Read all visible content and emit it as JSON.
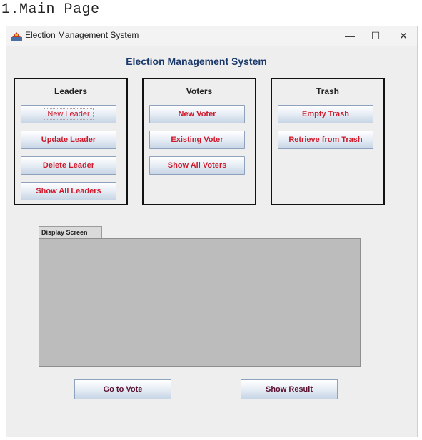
{
  "caption": "1.Main Page",
  "window": {
    "title": "Election Management System",
    "controls": {
      "minimize": "—",
      "maximize": "☐",
      "close": "✕"
    }
  },
  "heading": "Election Management System",
  "panels": {
    "leaders": {
      "title": "Leaders",
      "buttons": [
        "New Leader",
        "Update Leader",
        "Delete Leader",
        "Show All Leaders"
      ]
    },
    "voters": {
      "title": "Voters",
      "buttons": [
        "New Voter",
        "Existing Voter",
        "Show All Voters"
      ]
    },
    "trash": {
      "title": "Trash",
      "buttons": [
        "Empty Trash",
        "Retrieve from Trash"
      ]
    }
  },
  "display": {
    "tab_label": "Display Screen"
  },
  "actions": {
    "vote": "Go to Vote",
    "result": "Show Result"
  },
  "colors": {
    "heading": "#1b3a6b",
    "button_text": "#d01a2c",
    "bottom_button_text": "#5a1030",
    "display_bg": "#bcbcbc"
  }
}
